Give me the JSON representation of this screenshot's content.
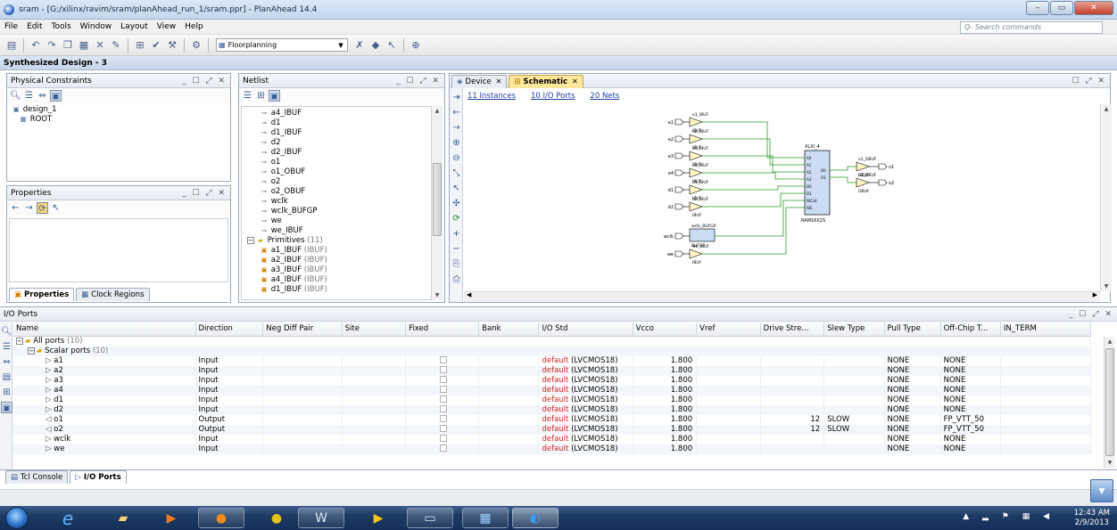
{
  "window": {
    "title": "sram - [G:/xilinx/ravim/sram/planAhead_run_1/sram.ppr] - PlanAhead 14.4"
  },
  "menu": [
    "File",
    "Edit",
    "Tools",
    "Window",
    "Layout",
    "View",
    "Help"
  ],
  "search": {
    "placeholder": "Q- Search commands"
  },
  "toolbar": {
    "layout_select": "Floorplanning"
  },
  "design": {
    "title": "Synthesized Design - 3"
  },
  "physical_constraints": {
    "title": "Physical Constraints",
    "items": [
      "design_1",
      "ROOT"
    ]
  },
  "properties": {
    "title": "Properties",
    "tabs": [
      "Properties",
      "Clock Regions"
    ]
  },
  "netlist": {
    "title": "Netlist",
    "items": [
      {
        "label": "a4_IBUF",
        "kind": "net"
      },
      {
        "label": "d1",
        "kind": "net"
      },
      {
        "label": "d1_IBUF",
        "kind": "net"
      },
      {
        "label": "d2",
        "kind": "net"
      },
      {
        "label": "d2_IBUF",
        "kind": "net"
      },
      {
        "label": "o1",
        "kind": "net"
      },
      {
        "label": "o1_OBUF",
        "kind": "net"
      },
      {
        "label": "o2",
        "kind": "net"
      },
      {
        "label": "o2_OBUF",
        "kind": "net"
      },
      {
        "label": "wclk",
        "kind": "net"
      },
      {
        "label": "wclk_BUFGP",
        "kind": "net"
      },
      {
        "label": "we",
        "kind": "net"
      },
      {
        "label": "we_IBUF",
        "kind": "net"
      }
    ],
    "primitives": {
      "label": "Primitives",
      "count": "(11)"
    },
    "prim_items": [
      {
        "label": "a1_IBUF",
        "type": "(IBUF)"
      },
      {
        "label": "a2_IBUF",
        "type": "(IBUF)"
      },
      {
        "label": "a3_IBUF",
        "type": "(IBUF)"
      },
      {
        "label": "a4_IBUF",
        "type": "(IBUF)"
      },
      {
        "label": "d1_IBUF",
        "type": "(IBUF)"
      }
    ]
  },
  "schematic": {
    "tabs": [
      {
        "label": "Device"
      },
      {
        "label": "Schematic"
      }
    ],
    "links": [
      "11 Instances",
      "10 I/O Ports",
      "20 Nets"
    ],
    "inputs": [
      "a1",
      "a2",
      "a3",
      "a4",
      "d1",
      "d2",
      "wclk",
      "we"
    ],
    "ibuf_labels": [
      "a1_IBUF",
      "a2_IBUF",
      "a3_IBUF",
      "a4_IBUF",
      "d1_IBUF",
      "d2_IBUF",
      "wclk_BUFGP",
      "we_IBUF"
    ],
    "ibuf_type": "IBUF",
    "bufgp_type": "BUFGP",
    "ram": {
      "name": "XLXI_4",
      "type": "RAM16X2S",
      "pins": [
        "A0",
        "A1",
        "A2",
        "A3",
        "D0",
        "D1",
        "WCLK",
        "WE"
      ],
      "outs": [
        "O0",
        "O1"
      ]
    },
    "outputs": [
      {
        "buf": "o1_OBUF",
        "port": "o1"
      },
      {
        "buf": "o2_OBUF",
        "port": "o2"
      }
    ],
    "obuf_type": "OBUF"
  },
  "io_ports": {
    "title": "I/O Ports",
    "columns": [
      "Name",
      "Direction",
      "Neg Diff Pair",
      "Site",
      "Fixed",
      "Bank",
      "I/O Std",
      "Vcco",
      "Vref",
      "Drive Stre...",
      "Slew Type",
      "Pull Type",
      "Off-Chip T...",
      "IN_TERM"
    ],
    "all_ports": {
      "label": "All ports",
      "count": "(10)"
    },
    "scalar_ports": {
      "label": "Scalar ports",
      "count": "(10)"
    },
    "rows": [
      {
        "name": "a1",
        "dir": "Input",
        "std_prefix": "default",
        "std": "(LVCMOS18)",
        "vcco": "1.800",
        "drive": "",
        "slew": "",
        "pull": "NONE",
        "offchip": "NONE"
      },
      {
        "name": "a2",
        "dir": "Input",
        "std_prefix": "default",
        "std": "(LVCMOS18)",
        "vcco": "1.800",
        "drive": "",
        "slew": "",
        "pull": "NONE",
        "offchip": "NONE"
      },
      {
        "name": "a3",
        "dir": "Input",
        "std_prefix": "default",
        "std": "(LVCMOS18)",
        "vcco": "1.800",
        "drive": "",
        "slew": "",
        "pull": "NONE",
        "offchip": "NONE"
      },
      {
        "name": "a4",
        "dir": "Input",
        "std_prefix": "default",
        "std": "(LVCMOS18)",
        "vcco": "1.800",
        "drive": "",
        "slew": "",
        "pull": "NONE",
        "offchip": "NONE"
      },
      {
        "name": "d1",
        "dir": "Input",
        "std_prefix": "default",
        "std": "(LVCMOS18)",
        "vcco": "1.800",
        "drive": "",
        "slew": "",
        "pull": "NONE",
        "offchip": "NONE"
      },
      {
        "name": "d2",
        "dir": "Input",
        "std_prefix": "default",
        "std": "(LVCMOS18)",
        "vcco": "1.800",
        "drive": "",
        "slew": "",
        "pull": "NONE",
        "offchip": "NONE"
      },
      {
        "name": "o1",
        "dir": "Output",
        "std_prefix": "default",
        "std": "(LVCMOS18)",
        "vcco": "1.800",
        "drive": "12",
        "slew": "SLOW",
        "pull": "NONE",
        "offchip": "FP_VTT_50"
      },
      {
        "name": "o2",
        "dir": "Output",
        "std_prefix": "default",
        "std": "(LVCMOS18)",
        "vcco": "1.800",
        "drive": "12",
        "slew": "SLOW",
        "pull": "NONE",
        "offchip": "FP_VTT_50"
      },
      {
        "name": "wclk",
        "dir": "Input",
        "std_prefix": "default",
        "std": "(LVCMOS18)",
        "vcco": "1.800",
        "drive": "",
        "slew": "",
        "pull": "NONE",
        "offchip": "NONE"
      },
      {
        "name": "we",
        "dir": "Input",
        "std_prefix": "default",
        "std": "(LVCMOS18)",
        "vcco": "1.800",
        "drive": "",
        "slew": "",
        "pull": "NONE",
        "offchip": "NONE"
      }
    ]
  },
  "bottom_tabs": [
    "Tcl Console",
    "I/O Ports"
  ],
  "taskbar": {
    "time": "12:43 AM",
    "date": "2/9/2013"
  }
}
